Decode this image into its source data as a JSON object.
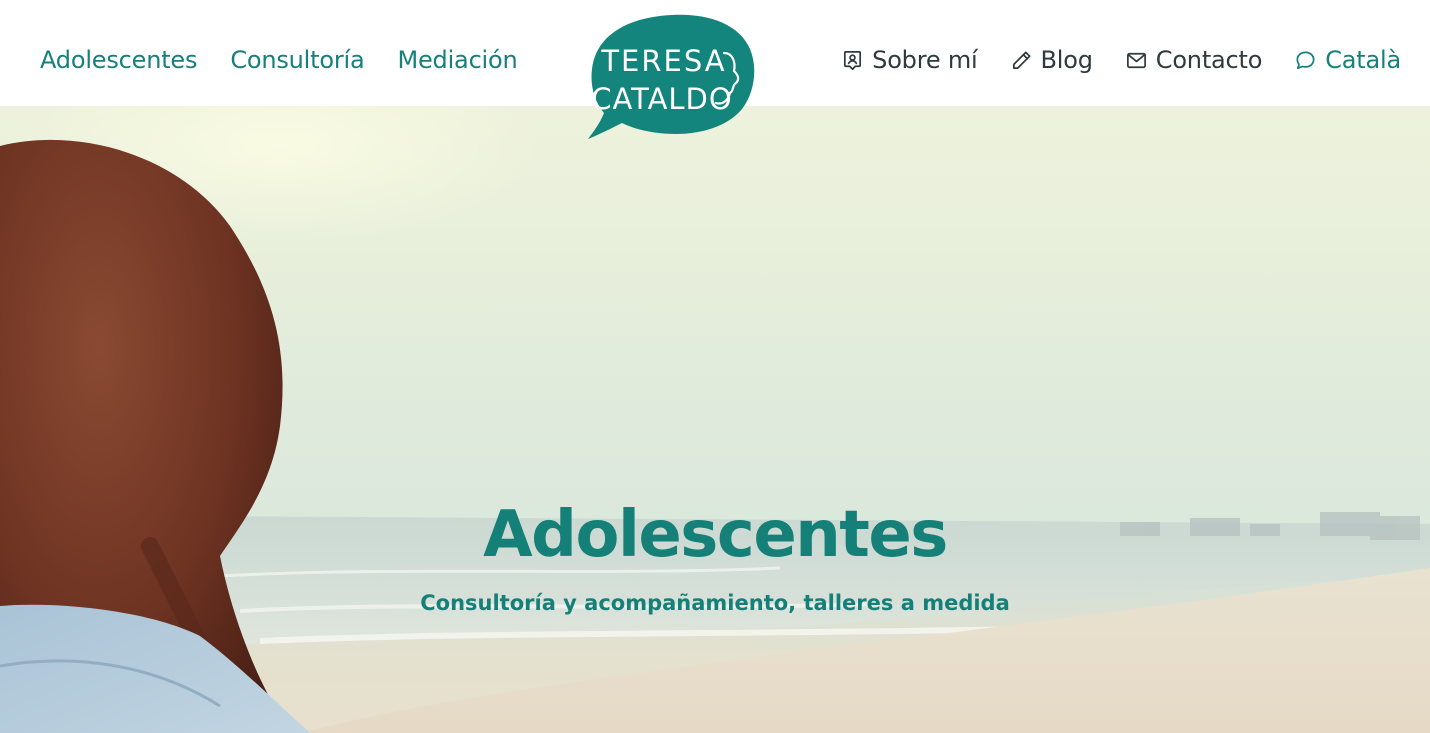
{
  "header": {
    "nav_left": [
      {
        "label": "Adolescentes"
      },
      {
        "label": "Consultoría"
      },
      {
        "label": "Mediación"
      }
    ],
    "logo": {
      "line1": "TERESA",
      "line2": "CATALDO",
      "color": "#14857c"
    },
    "nav_right": [
      {
        "label": "Sobre mí",
        "icon": "user-badge-icon"
      },
      {
        "label": "Blog",
        "icon": "pencil-icon"
      },
      {
        "label": "Contacto",
        "icon": "envelope-icon"
      },
      {
        "label": "Català",
        "icon": "chat-bubble-icon"
      }
    ]
  },
  "hero": {
    "title": "Adolescentes",
    "subtitle": "Consultoría y acompañamiento, talleres a medida",
    "accent_color": "#148078"
  }
}
